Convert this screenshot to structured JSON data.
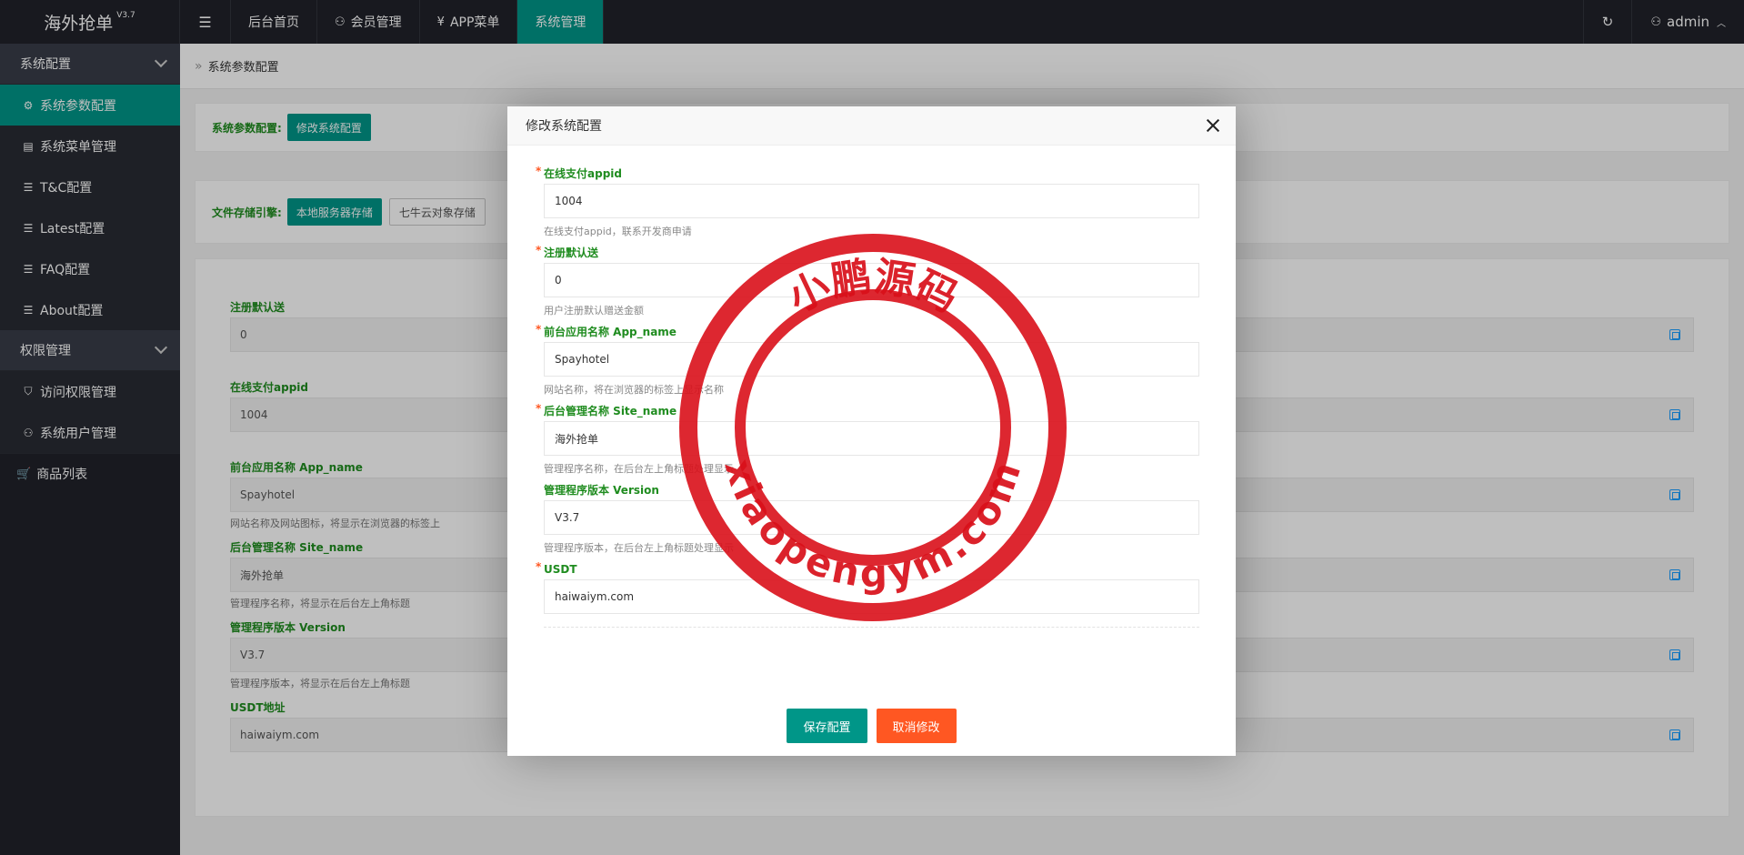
{
  "app": {
    "title": "海外抢单",
    "version": "V3.7"
  },
  "topnav": {
    "items": [
      {
        "label": "后台首页"
      },
      {
        "label": "会员管理"
      },
      {
        "label": "APP菜单"
      },
      {
        "label": "系统管理"
      }
    ],
    "user": "admin"
  },
  "sidebar": {
    "group1": "系统配置",
    "items1": [
      {
        "label": "系统参数配置"
      },
      {
        "label": "系统菜单管理"
      },
      {
        "label": "T&C配置"
      },
      {
        "label": "Latest配置"
      },
      {
        "label": "FAQ配置"
      },
      {
        "label": "About配置"
      }
    ],
    "group2": "权限管理",
    "items2": [
      {
        "label": "访问权限管理"
      },
      {
        "label": "系统用户管理"
      }
    ],
    "goods": "商品列表"
  },
  "page": {
    "breadcrumb": "系统参数配置",
    "config_label": "系统参数配置:",
    "config_button": "修改系统配置",
    "storage_label": "文件存储引擎:",
    "storage_local": "本地服务器存储",
    "storage_qiniu": "七牛云对象存储",
    "fields": [
      {
        "label": "注册默认送",
        "value": "0",
        "hint": ""
      },
      {
        "label": "在线支付appid",
        "value": "1004",
        "hint": ""
      },
      {
        "label": "前台应用名称 App_name",
        "value": "Spayhotel",
        "hint": "网站名称及网站图标，将显示在浏览器的标签上"
      },
      {
        "label": "后台管理名称 Site_name",
        "value": "海外抢单",
        "hint": "管理程序名称，将显示在后台左上角标题"
      },
      {
        "label": "管理程序版本 Version",
        "value": "V3.7",
        "hint": "管理程序版本，将显示在后台左上角标题"
      },
      {
        "label": "USDT地址",
        "value": "haiwaiym.com",
        "hint": ""
      }
    ]
  },
  "modal": {
    "title": "修改系统配置",
    "fields": [
      {
        "label": "在线支付appid",
        "value": "1004",
        "hint": "在线支付appid，联系开发商申请"
      },
      {
        "label": "注册默认送",
        "value": "0",
        "hint": "用户注册默认赠送金额"
      },
      {
        "label": "前台应用名称 App_name",
        "value": "Spayhotel",
        "hint": "网站名称，将在浏览器的标签上显示名称"
      },
      {
        "label": "后台管理名称 Site_name",
        "value": "海外抢单",
        "hint": "管理程序名称，在后台左上角标题处理显示"
      },
      {
        "label": "管理程序版本 Version",
        "value": "V3.7",
        "hint": "管理程序版本，在后台左上角标题处理显示"
      },
      {
        "label": "USDT",
        "value": "haiwaiym.com",
        "hint": ""
      }
    ],
    "required_mark": "*",
    "save": "保存配置",
    "cancel": "取消修改"
  },
  "stamp": {
    "top_text": "小鹏源码",
    "bottom_text": "xiaopengym.com",
    "color": "#D9101A"
  }
}
